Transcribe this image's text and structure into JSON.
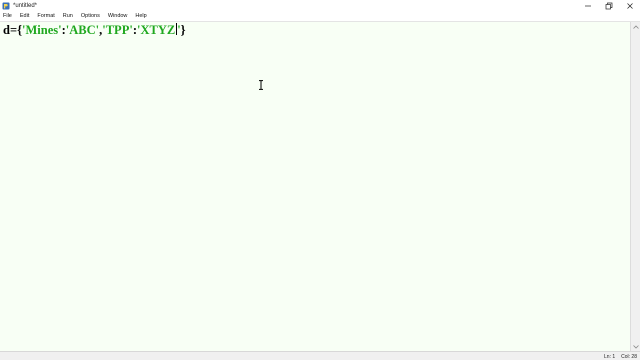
{
  "window": {
    "title": "*untitled*",
    "icon": "idle-app-icon"
  },
  "menu": {
    "items": [
      {
        "label": "File"
      },
      {
        "label": "Edit"
      },
      {
        "label": "Format"
      },
      {
        "label": "Run"
      },
      {
        "label": "Options"
      },
      {
        "label": "Window"
      },
      {
        "label": "Help"
      }
    ]
  },
  "editor": {
    "line1": {
      "p1": "d={",
      "s1": "'Mines'",
      "p2": ":",
      "s2": "'ABC'",
      "p3": ",",
      "s3": "'TPP'",
      "p4": ":",
      "s4": "'XTYZ",
      "s5": "'",
      "p5": "}"
    },
    "string_color": "#1fa81f",
    "background": "#f8fff5"
  },
  "status": {
    "line": "Ln: 1",
    "col": "Col: 28"
  }
}
